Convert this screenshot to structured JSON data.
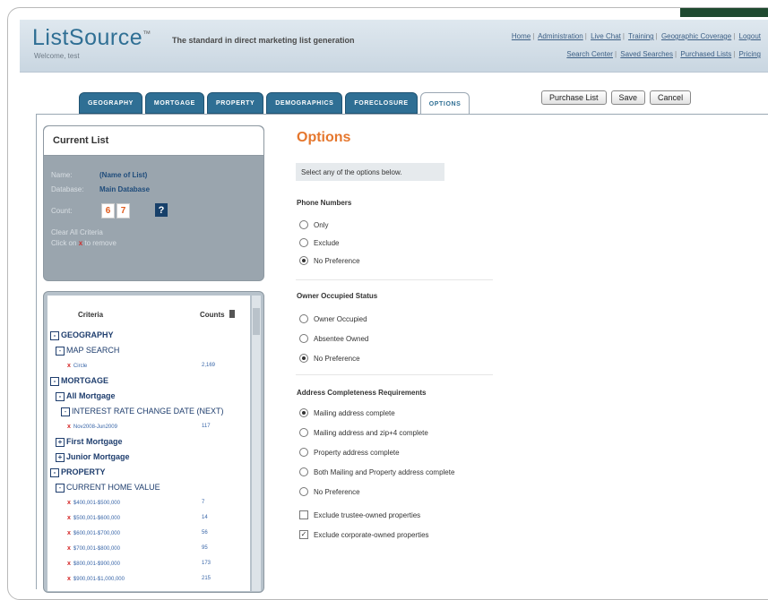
{
  "header": {
    "logo": "ListSource",
    "tm": "™",
    "tagline": "The standard in direct marketing list generation",
    "welcome": "Welcome, test",
    "links_row1": [
      "Home",
      "Administration",
      "Live Chat",
      "Training",
      "Geographic Coverage",
      "Logout"
    ],
    "links_row2": [
      "Search Center",
      "Saved Searches",
      "Purchased Lists",
      "Pricing"
    ]
  },
  "tabs": [
    "GEOGRAPHY",
    "MORTGAGE",
    "PROPERTY",
    "DEMOGRAPHICS",
    "FORECLOSURE",
    "OPTIONS"
  ],
  "active_tab": "OPTIONS",
  "actions": {
    "purchase": "Purchase List",
    "save": "Save",
    "cancel": "Cancel"
  },
  "current_list": {
    "title": "Current List",
    "name_label": "Name:",
    "name_value": "(Name of List)",
    "database_label": "Database:",
    "database_value": "Main Database",
    "count_label": "Count:",
    "count_digits": [
      "6",
      "7"
    ],
    "help": "?",
    "clear_all": "Clear All Criteria",
    "click_hint": "Click on",
    "click_hint2": "to remove"
  },
  "criteria": {
    "header": "Criteria",
    "counts_header": "Counts",
    "lines": [
      {
        "text": "GEOGRAPHY",
        "level": 0,
        "bold": true,
        "box": "-"
      },
      {
        "text": "MAP SEARCH",
        "level": 1,
        "bold": false,
        "box": "-"
      },
      {
        "sub": "Circle",
        "count": "2,169"
      },
      {
        "text": "MORTGAGE",
        "level": 0,
        "bold": true,
        "box": "-"
      },
      {
        "text": "All Mortgage",
        "level": 1,
        "bold": true,
        "box": "-"
      },
      {
        "text": "INTEREST RATE CHANGE DATE (NEXT)",
        "level": 2,
        "bold": false,
        "box": "-"
      },
      {
        "sub": "Nov2008-Jun2009",
        "count": "117"
      },
      {
        "text": "First Mortgage",
        "level": 1,
        "bold": true,
        "box": "+"
      },
      {
        "text": "Junior Mortgage",
        "level": 1,
        "bold": true,
        "box": "+"
      },
      {
        "text": "PROPERTY",
        "level": 0,
        "bold": true,
        "box": "-"
      },
      {
        "text": "CURRENT HOME VALUE",
        "level": 1,
        "bold": false,
        "box": "-"
      },
      {
        "sub": "$400,001-$500,000",
        "count": "7"
      },
      {
        "sub": "$500,001-$600,000",
        "count": "14"
      },
      {
        "sub": "$600,001-$700,000",
        "count": "56"
      },
      {
        "sub": "$700,001-$800,000",
        "count": "95"
      },
      {
        "sub": "$800,001-$900,000",
        "count": "173"
      },
      {
        "sub": "$900,001-$1,000,000",
        "count": "215"
      }
    ]
  },
  "options": {
    "title": "Options",
    "note": "Select any of the options below.",
    "phone": {
      "label": "Phone Numbers",
      "choices": [
        "Only",
        "Exclude",
        "No Preference"
      ],
      "selected": 2
    },
    "owner": {
      "label": "Owner Occupied Status",
      "choices": [
        "Owner Occupied",
        "Absentee Owned",
        "No Preference"
      ],
      "selected": 2
    },
    "address": {
      "label": "Address Completeness Requirements",
      "choices": [
        "Mailing address complete",
        "Mailing address and zip+4 complete",
        "Property address complete",
        "Both Mailing and Property address complete",
        "No Preference"
      ],
      "selected": 0
    },
    "checks": [
      {
        "label": "Exclude trustee-owned properties",
        "checked": false
      },
      {
        "label": "Exclude corporate-owned properties",
        "checked": true
      }
    ]
  }
}
